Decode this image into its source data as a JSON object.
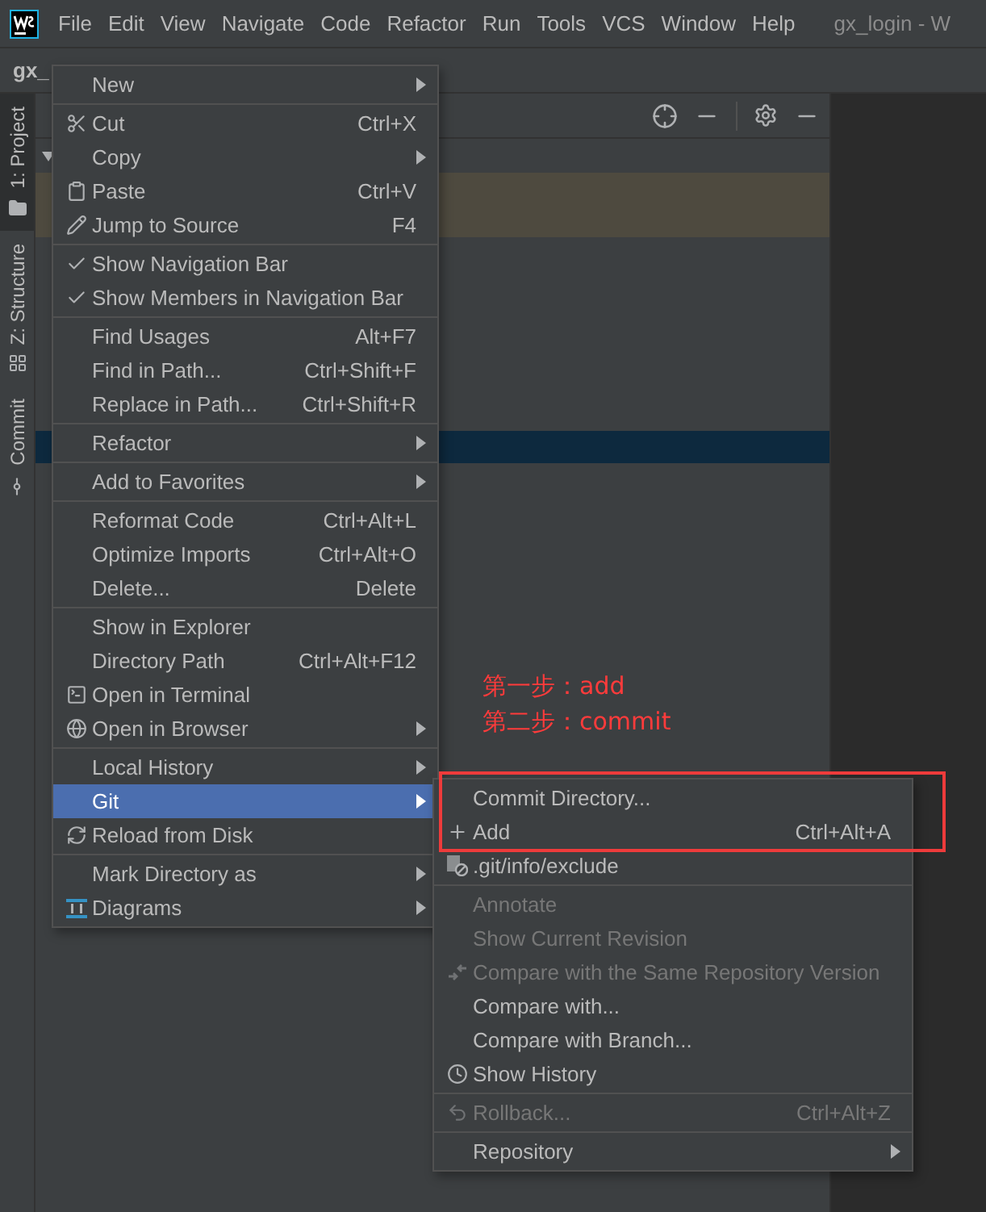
{
  "window": {
    "title": "gx_login - W"
  },
  "menu_bar": [
    "File",
    "Edit",
    "View",
    "Navigate",
    "Code",
    "Refactor",
    "Run",
    "Tools",
    "VCS",
    "Window",
    "Help"
  ],
  "breadcrumb": "gx_",
  "tool_strip": [
    {
      "label": "1: Project",
      "selected": true
    },
    {
      "label": "Z: Structure",
      "selected": false
    },
    {
      "label": "Commit",
      "selected": false
    }
  ],
  "context_menu": {
    "groups": [
      [
        {
          "label": "New",
          "submenu": true,
          "checked": false,
          "selected": false
        }
      ],
      [
        {
          "label": "Cut",
          "shortcut": "Ctrl+X",
          "checked": false,
          "selected": false
        },
        {
          "label": "Copy",
          "submenu": true,
          "checked": false,
          "selected": false
        },
        {
          "label": "Paste",
          "shortcut": "Ctrl+V",
          "checked": false,
          "selected": false
        },
        {
          "label": "Jump to Source",
          "shortcut": "F4",
          "checked": false,
          "selected": false
        }
      ],
      [
        {
          "label": "Show Navigation Bar",
          "checked": true,
          "selected": false
        },
        {
          "label": "Show Members in Navigation Bar",
          "checked": true,
          "selected": false
        }
      ],
      [
        {
          "label": "Find Usages",
          "shortcut": "Alt+F7",
          "checked": false,
          "selected": false
        },
        {
          "label": "Find in Path...",
          "shortcut": "Ctrl+Shift+F",
          "checked": false,
          "selected": false
        },
        {
          "label": "Replace in Path...",
          "shortcut": "Ctrl+Shift+R",
          "checked": false,
          "selected": false
        }
      ],
      [
        {
          "label": "Refactor",
          "submenu": true,
          "checked": false,
          "selected": false
        }
      ],
      [
        {
          "label": "Add to Favorites",
          "submenu": true,
          "checked": false,
          "selected": false
        }
      ],
      [
        {
          "label": "Reformat Code",
          "shortcut": "Ctrl+Alt+L",
          "checked": false,
          "selected": false
        },
        {
          "label": "Optimize Imports",
          "shortcut": "Ctrl+Alt+O",
          "checked": false,
          "selected": false
        },
        {
          "label": "Delete...",
          "shortcut": "Delete",
          "checked": false,
          "selected": false
        }
      ],
      [
        {
          "label": "Show in Explorer",
          "checked": false,
          "selected": false
        },
        {
          "label": "Directory Path",
          "shortcut": "Ctrl+Alt+F12",
          "checked": false,
          "selected": false
        },
        {
          "label": "Open in Terminal",
          "checked": false,
          "selected": false
        },
        {
          "label": "Open in Browser",
          "submenu": true,
          "checked": false,
          "selected": false
        }
      ],
      [
        {
          "label": "Local History",
          "submenu": true,
          "checked": false,
          "selected": false
        },
        {
          "label": "Git",
          "submenu": true,
          "checked": false,
          "selected": true
        },
        {
          "label": "Reload from Disk",
          "checked": false,
          "selected": false
        }
      ],
      [
        {
          "label": "Mark Directory as",
          "submenu": true,
          "checked": false,
          "selected": false
        },
        {
          "label": "Diagrams",
          "submenu": true,
          "checked": false,
          "selected": false
        }
      ]
    ]
  },
  "git_submenu": {
    "groups": [
      [
        {
          "label": "Commit Directory...",
          "disabled": false
        },
        {
          "label": "Add",
          "shortcut": "Ctrl+Alt+A",
          "disabled": false
        },
        {
          "label": ".git/info/exclude",
          "disabled": false
        }
      ],
      [
        {
          "label": "Annotate",
          "disabled": true
        },
        {
          "label": "Show Current Revision",
          "disabled": true
        },
        {
          "label": "Compare with the Same Repository Version",
          "disabled": true
        },
        {
          "label": "Compare with...",
          "disabled": false
        },
        {
          "label": "Compare with Branch...",
          "disabled": false
        },
        {
          "label": "Show History",
          "disabled": false
        }
      ],
      [
        {
          "label": "Rollback...",
          "shortcut": "Ctrl+Alt+Z",
          "disabled": true
        }
      ],
      [
        {
          "label": "Repository",
          "submenu": true,
          "disabled": false
        }
      ]
    ]
  },
  "annotations": [
    "第一步：add",
    "第二步：commit"
  ]
}
